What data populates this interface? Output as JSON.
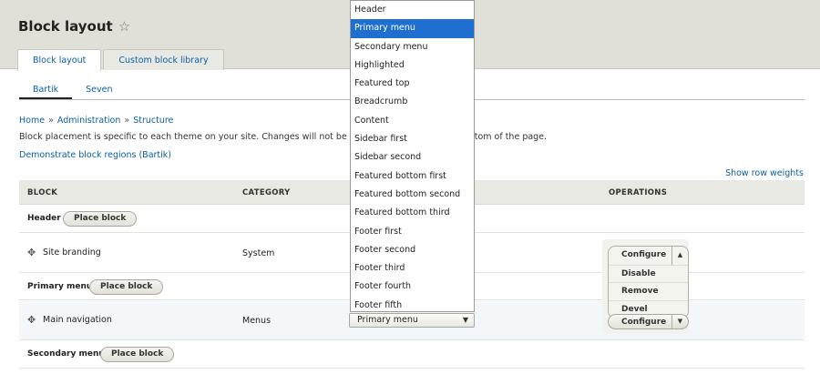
{
  "page": {
    "title": "Block layout"
  },
  "tabs": [
    "Block layout",
    "Custom block library"
  ],
  "subtabs": [
    "Bartik",
    "Seven"
  ],
  "breadcrumb": [
    "Home",
    "Administration",
    "Structure"
  ],
  "breadcrumb_sep": "»",
  "help_text": "Block placement is specific to each theme on your site. Changes will not be saved unt",
  "help_text_tail": "ttom of the page.",
  "demo_link": "Demonstrate block regions (Bartik)",
  "row_weights_link": "Show row weights",
  "table": {
    "headers": {
      "block": "BLOCK",
      "category": "CATEGORY",
      "operations": "OPERATIONS"
    },
    "place_block_label": "Place block",
    "regions": {
      "header": "Header",
      "primary_menu": "Primary menu",
      "secondary_menu": "Secondary menu"
    },
    "blocks": {
      "site_branding": {
        "name": "Site branding",
        "category": "System"
      },
      "main_navigation": {
        "name": "Main navigation",
        "category": "Menus",
        "region": "Primary menu"
      }
    }
  },
  "region_dropdown": {
    "selected": "Primary menu",
    "options": [
      "Header",
      "Primary menu",
      "Secondary menu",
      "Highlighted",
      "Featured top",
      "Breadcrumb",
      "Content",
      "Sidebar first",
      "Sidebar second",
      "Featured bottom first",
      "Featured bottom second",
      "Featured bottom third",
      "Footer first",
      "Footer second",
      "Footer third",
      "Footer fourth",
      "Footer fifth"
    ]
  },
  "operations": {
    "open_menu": [
      "Configure",
      "Disable",
      "Remove",
      "Devel"
    ],
    "configure_label": "Configure"
  }
}
